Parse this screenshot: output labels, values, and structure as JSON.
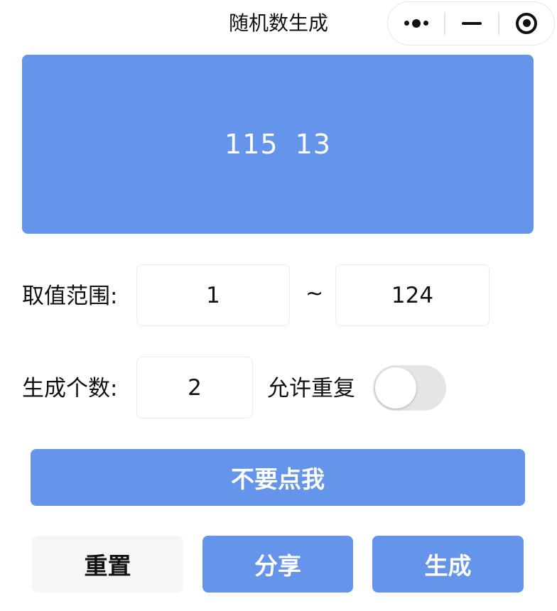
{
  "window": {
    "title": "随机数生成"
  },
  "capsule": {
    "more_icon": "more-dots-icon",
    "minimize_icon": "minus-icon",
    "close_icon": "target-circle-icon"
  },
  "result": {
    "numbers": [
      "115",
      "13"
    ]
  },
  "range": {
    "label": "取值范围:",
    "min": "1",
    "separator": "~",
    "max": "124"
  },
  "count": {
    "label": "生成个数:",
    "value": "2",
    "allow_repeat_label": "允许重复",
    "allow_repeat": false
  },
  "buttons": {
    "dont_click": "不要点我",
    "reset": "重置",
    "share": "分享",
    "generate": "生成"
  },
  "colors": {
    "accent": "#6495ea",
    "secondary_button": "#f6f6f6",
    "toggle_off": "#e5e5e5"
  }
}
